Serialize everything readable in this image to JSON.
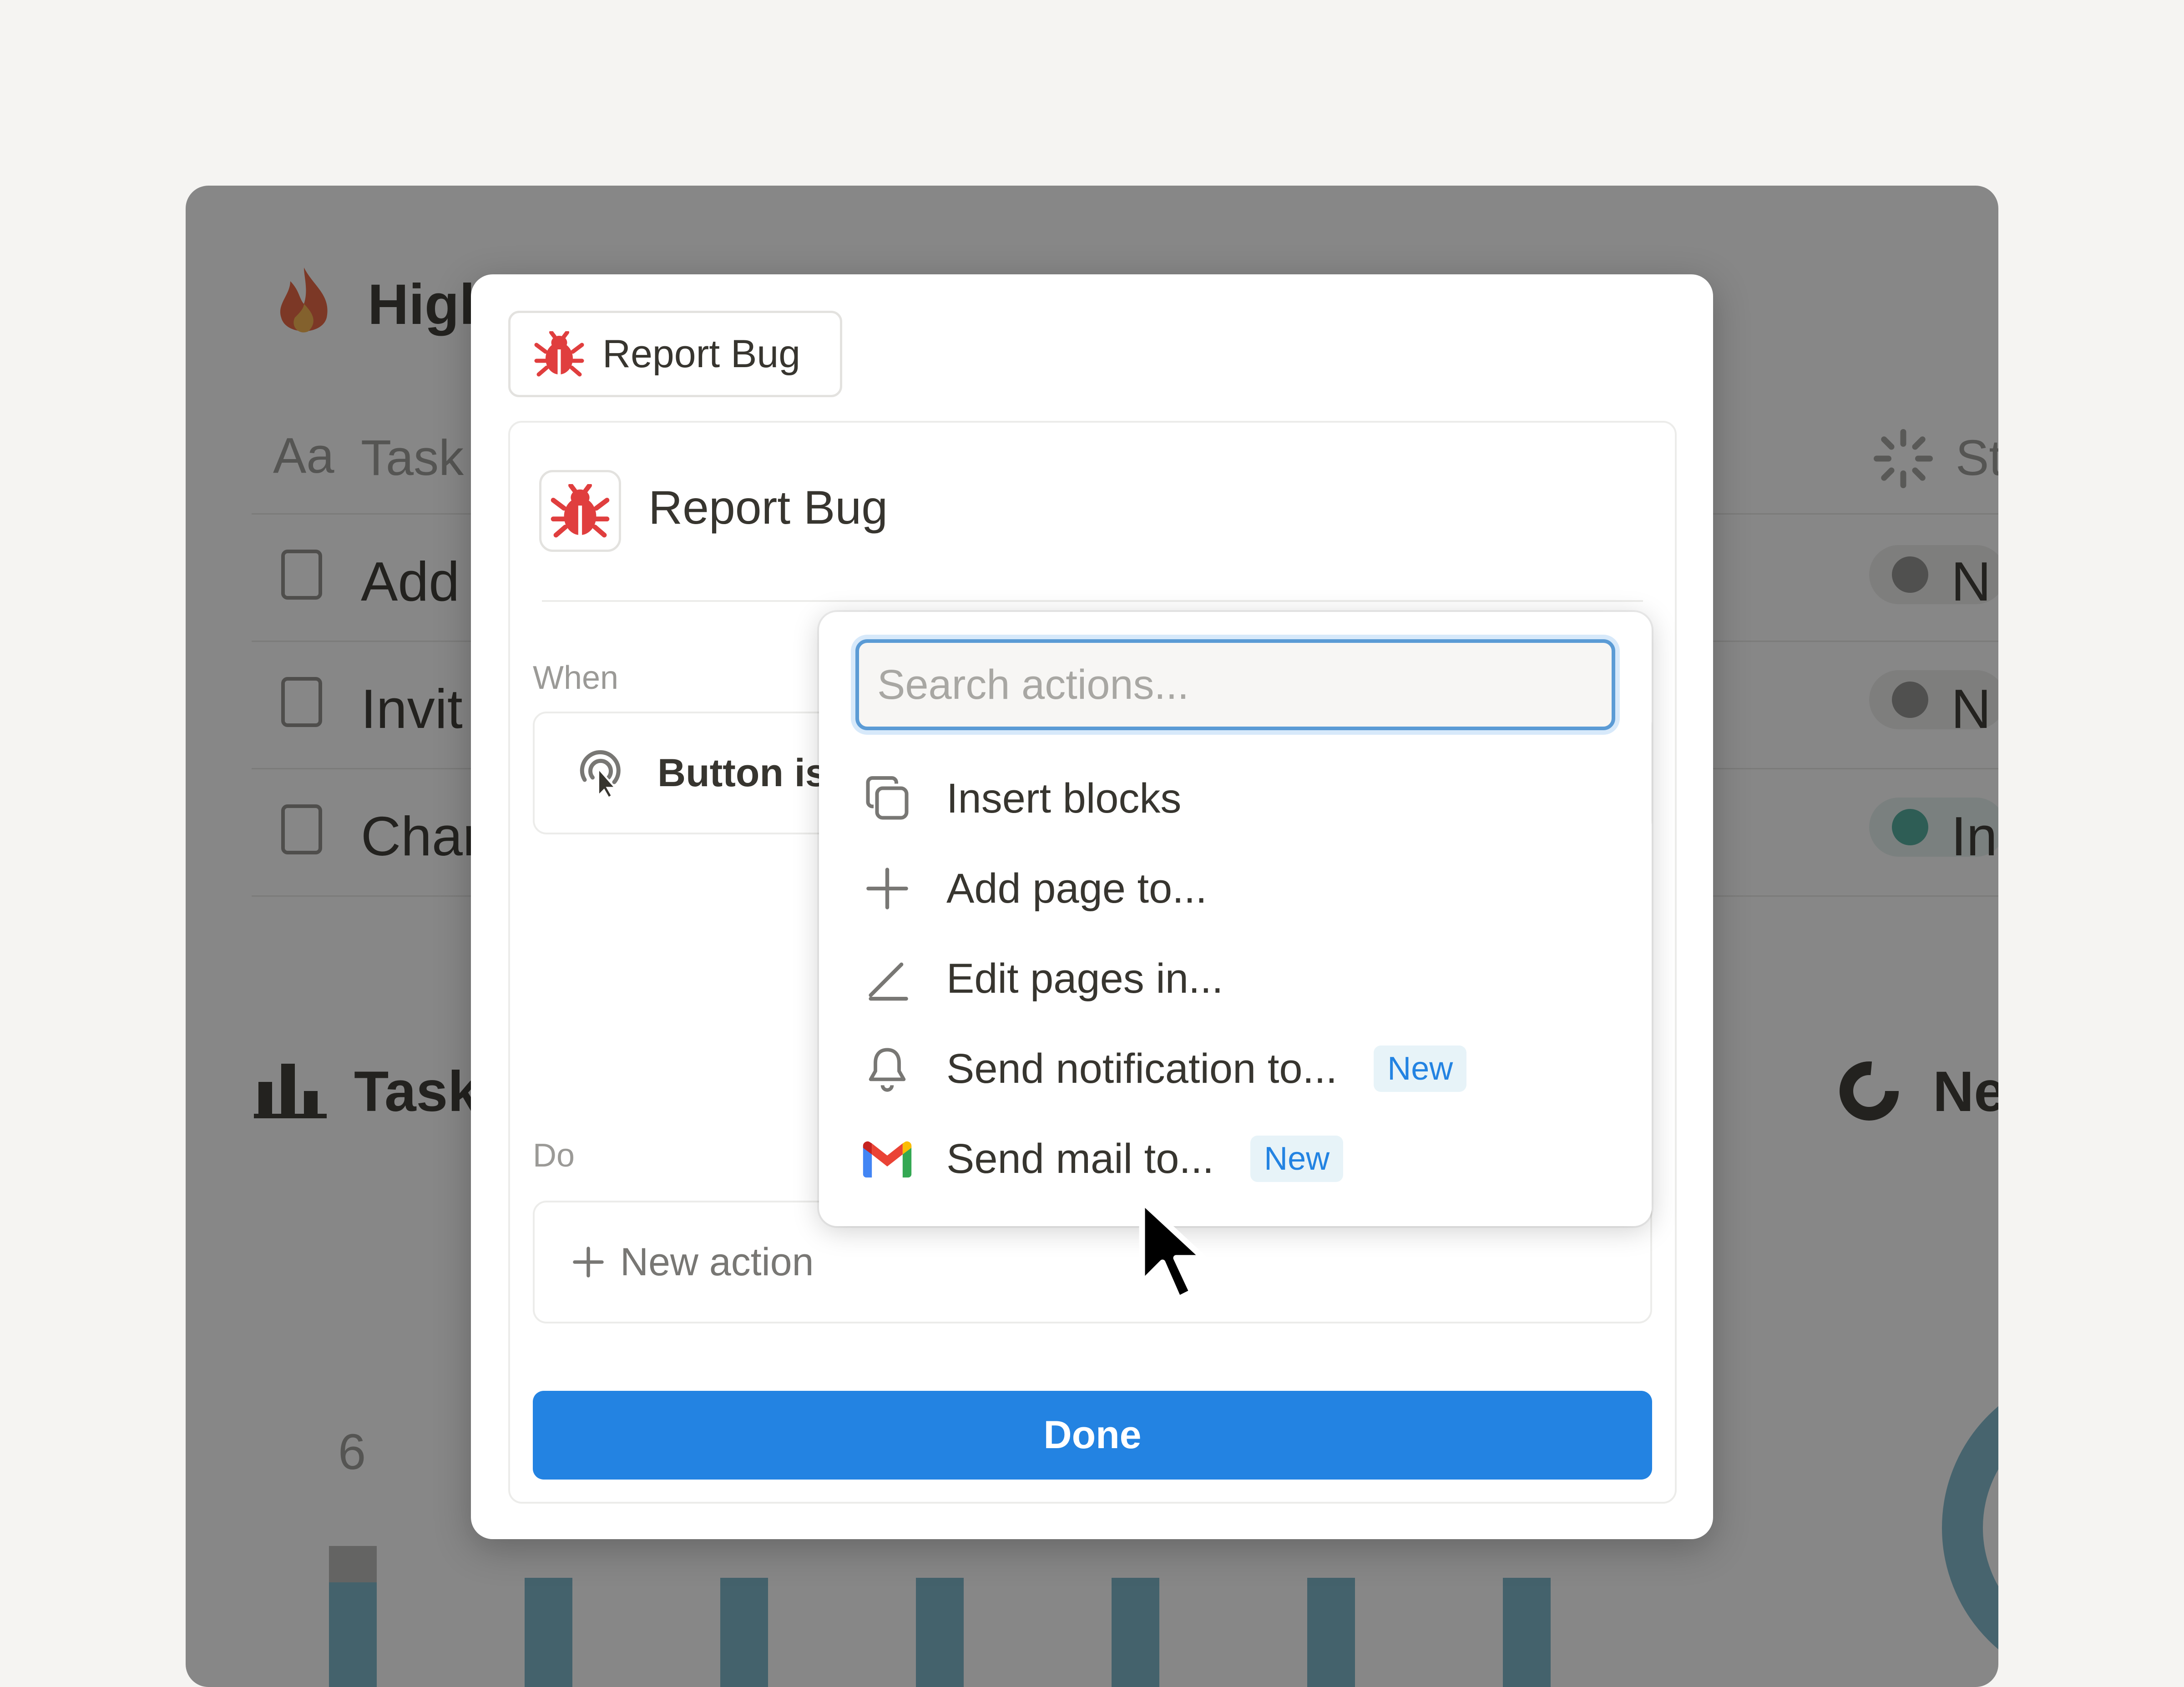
{
  "background": {
    "title": "Higl",
    "column_task": "Task",
    "column_status": "St",
    "rows": [
      {
        "label": "Add",
        "status": "N"
      },
      {
        "label": "Invit",
        "status": "N"
      },
      {
        "label": "Char",
        "status": "In"
      }
    ],
    "chart_title": "Task",
    "donut_title": "Ne",
    "axis_value": "6",
    "aa_label": "Aa"
  },
  "modal": {
    "chip_label": "Report Bug",
    "panel_title": "Report Bug",
    "when_label": "When",
    "trigger_label": "Button is",
    "do_label": "Do",
    "new_action_label": "New action",
    "done_label": "Done"
  },
  "dropdown": {
    "search_placeholder": "Search actions...",
    "items": [
      {
        "label": "Insert blocks",
        "icon": "copy-icon",
        "badge": ""
      },
      {
        "label": "Add page to...",
        "icon": "plus-icon",
        "badge": ""
      },
      {
        "label": "Edit pages in...",
        "icon": "pencil-icon",
        "badge": ""
      },
      {
        "label": "Send notification to...",
        "icon": "bell-icon",
        "badge": "New"
      },
      {
        "label": "Send mail to...",
        "icon": "gmail-icon",
        "badge": "New"
      }
    ]
  },
  "colors": {
    "accent": "#2383e2",
    "bug_red": "#e03e3e",
    "badge_bg": "#e7f3f8"
  }
}
